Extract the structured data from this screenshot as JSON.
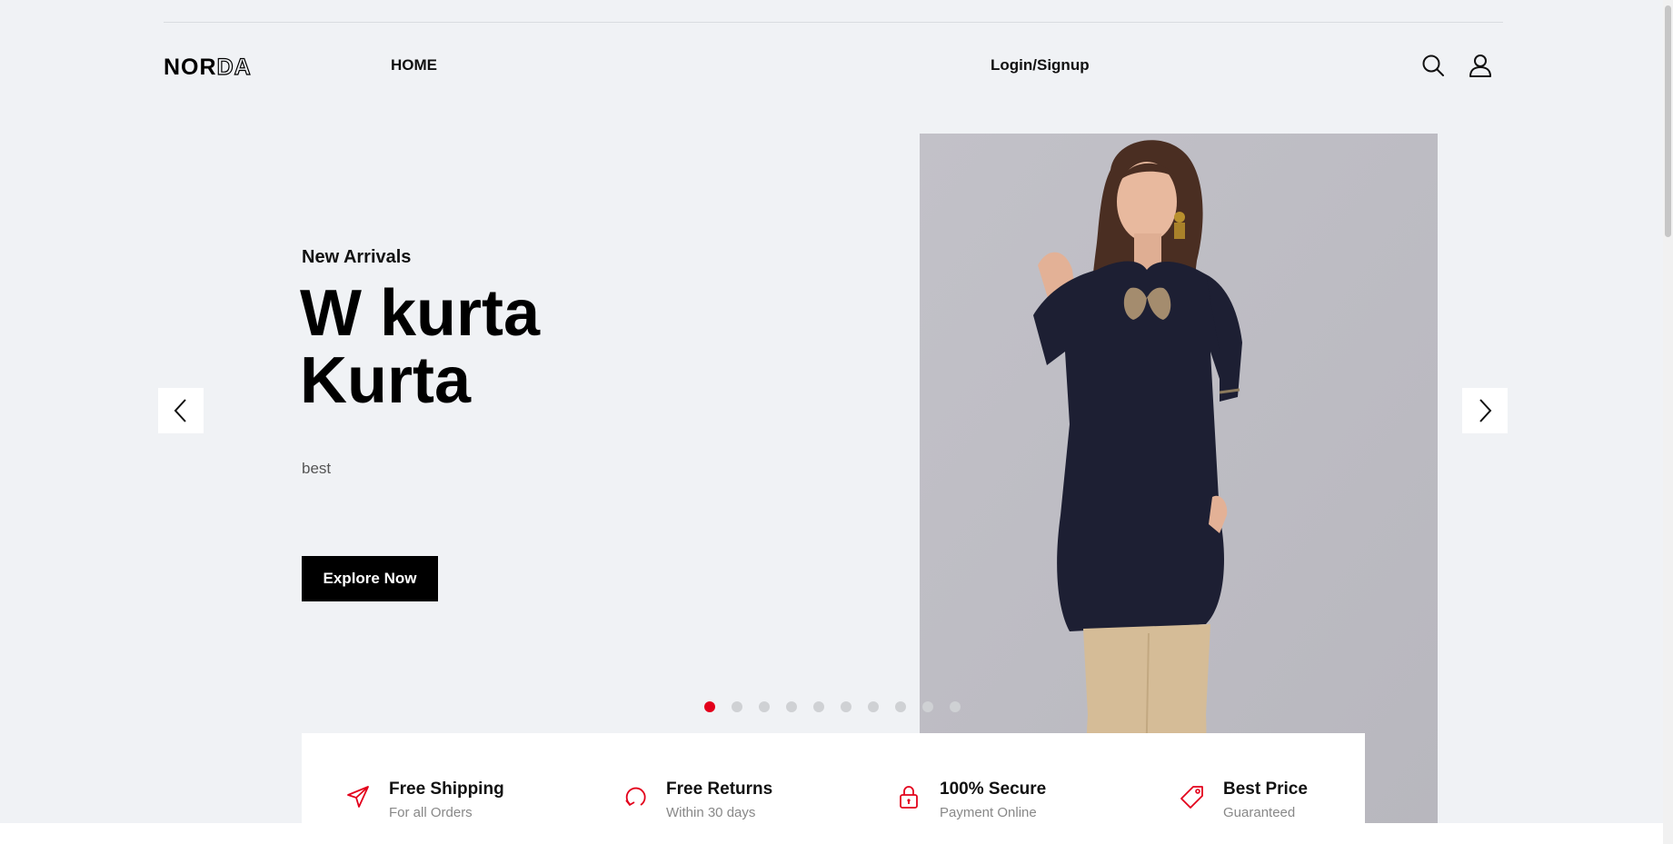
{
  "header": {
    "logo": {
      "bold": "NOR",
      "outline": "DA"
    },
    "nav_home": "HOME",
    "nav_login": "Login/Signup",
    "icons": [
      "search-icon",
      "user-icon"
    ]
  },
  "hero": {
    "subtitle": "New Arrivals",
    "title_line1": "W kurta",
    "title_line2": "Kurta",
    "description": "best",
    "cta_label": "Explore Now",
    "image": "woman-in-navy-kurta-photo"
  },
  "carousel": {
    "slide_count": 10,
    "active_index": 0,
    "prev_icon": "chevron-left-icon",
    "next_icon": "chevron-right-icon",
    "active_color": "#e3001b"
  },
  "features": [
    {
      "icon": "send-icon",
      "title": "Free Shipping",
      "subtitle": "For all Orders"
    },
    {
      "icon": "refresh-icon",
      "title": "Free Returns",
      "subtitle": "Within 30 days"
    },
    {
      "icon": "lock-icon",
      "title": "100% Secure",
      "subtitle": "Payment Online"
    },
    {
      "icon": "tag-icon",
      "title": "Best Price",
      "subtitle": "Guaranteed"
    }
  ],
  "colors": {
    "background": "#f0f2f5",
    "accent": "#e3001b",
    "button": "#000000"
  }
}
